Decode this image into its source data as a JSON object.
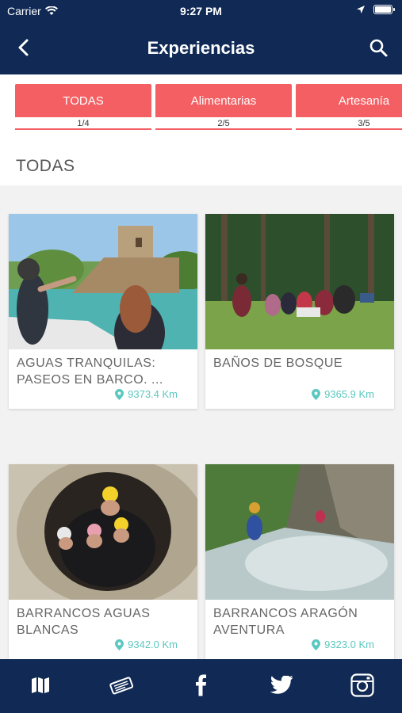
{
  "status": {
    "carrier": "Carrier",
    "time": "9:27 PM"
  },
  "nav": {
    "title": "Experiencias",
    "back_icon": "chevron-left-icon",
    "search_icon": "search-icon"
  },
  "tabs": [
    {
      "label": "TODAS",
      "count": "1/4"
    },
    {
      "label": "Alimentarias",
      "count": "2/5"
    },
    {
      "label": "Artesanía",
      "count": "3/5"
    }
  ],
  "section": {
    "title": "TODAS"
  },
  "cards": [
    {
      "title": "AGUAS TRANQUILAS: PASEOS EN BARCO. ...",
      "distance": "9373.4 Km"
    },
    {
      "title": "BAÑOS DE BOSQUE",
      "distance": "9365.9 Km"
    },
    {
      "title": "BARRANCOS AGUAS BLANCAS",
      "distance": "9342.0 Km"
    },
    {
      "title": "BARRANCOS ARAGÓN AVENTURA",
      "distance": "9323.0 Km"
    }
  ],
  "bottom_nav": [
    {
      "icon": "map-icon"
    },
    {
      "icon": "ticket-icon"
    },
    {
      "icon": "facebook-icon"
    },
    {
      "icon": "twitter-icon"
    },
    {
      "icon": "instagram-icon"
    }
  ],
  "colors": {
    "primary": "#102a55",
    "tab": "#f35f62",
    "distance": "#5bc8c0"
  }
}
